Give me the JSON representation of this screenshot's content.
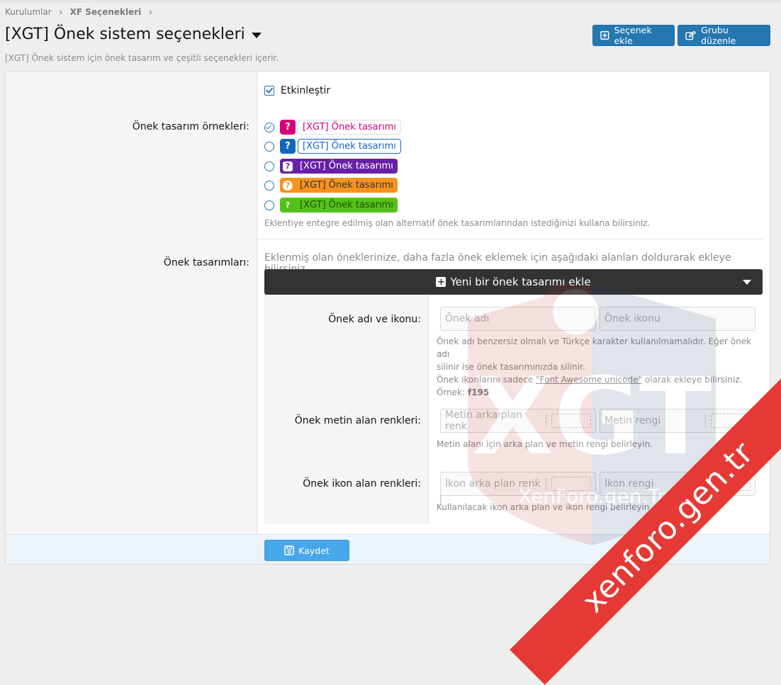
{
  "breadcrumb": {
    "items": [
      "Kurulumlar",
      "XF Seçenekleri"
    ]
  },
  "page": {
    "title": "[XGT] Önek sistem seçenekleri",
    "description": "[XGT] Önek sistem için önek tasarım ve çeşitli seçenekleri içerir."
  },
  "buttons": {
    "add_option": "Seçenek ekle",
    "edit_group": "Grubu düzenle",
    "save": "Kaydet"
  },
  "form": {
    "enable_label": "Etkinleştir",
    "enable_checked": true,
    "examples_label": "Önek tasarım örnekleri:",
    "prefix_options": [
      {
        "text": "[XGT] Önek tasarımı",
        "selected": true,
        "color": "#d4007a",
        "icon": "question-square-icon"
      },
      {
        "text": "[XGT] Önek tasarımı",
        "selected": false,
        "color": "#1565c0",
        "icon": "question-square-icon"
      },
      {
        "text": "[XGT] Önek tasarımı",
        "selected": false,
        "color": "#6a1fa8",
        "icon": "question-square-icon"
      },
      {
        "text": "[XGT] Önek tasarımı",
        "selected": false,
        "color": "#f7921e",
        "icon": "question-circle-icon"
      },
      {
        "text": "[XGT] Önek tasarımı",
        "selected": false,
        "color": "#55c01b",
        "icon": "question-icon"
      }
    ],
    "examples_hint": "Eklentiye entegre edilmiş olan alternatif önek tasarımlarından istediğinizi kullana bilirsiniz.",
    "designs_label": "Önek tasarımları:",
    "designs_intro": "Eklenmiş olan öneklerinize, daha fazla önek eklemek için aşağıdaki alanları doldurarak ekleye bilirsiniz.",
    "accordion_title": "Yeni bir önek tasarımı ekle",
    "name_icon_label": "Önek adı ve ikonu:",
    "name_placeholder": "Önek adı",
    "icon_placeholder": "Önek ikonu",
    "name_hint_1": "Önek adı benzersiz olmalı ve Türkçe karakter kullanılmamalıdır. Eğer önek adı",
    "name_hint_2": "silinir ise önek tasarımınızda silinir.",
    "icon_hint_pre": "Önek ikonlarını sadece ",
    "icon_hint_link": "\"Font Awesome unicode\"",
    "icon_hint_post": " olarak ekleye bilirsiniz.",
    "example_prefix": "Örnek: ",
    "example_value": "f195",
    "text_colors_label": "Önek metin alan renkleri:",
    "text_bg_placeholder": "Metin arka plan renk",
    "text_color_placeholder": "Metin rengi",
    "text_colors_hint": "Metin alanı için arka plan ve metin rengi belirleyin.",
    "icon_colors_label": "Önek ikon alan renkleri:",
    "icon_bg_placeholder": "İkon arka plan renk",
    "icon_color_placeholder": "İkon rengi",
    "icon_colors_hint": "Kullanılacak ikon arka plan ve ikon rengi belirleyin."
  },
  "watermark": {
    "ribbon_text": "xenforo.gen.tr",
    "logo_text": "XGT",
    "logo_sub": "XenForo.gen.Tr"
  },
  "colors": {
    "accent": "#2577b1",
    "save": "#47a7eb",
    "ribbon": "#e53935"
  }
}
